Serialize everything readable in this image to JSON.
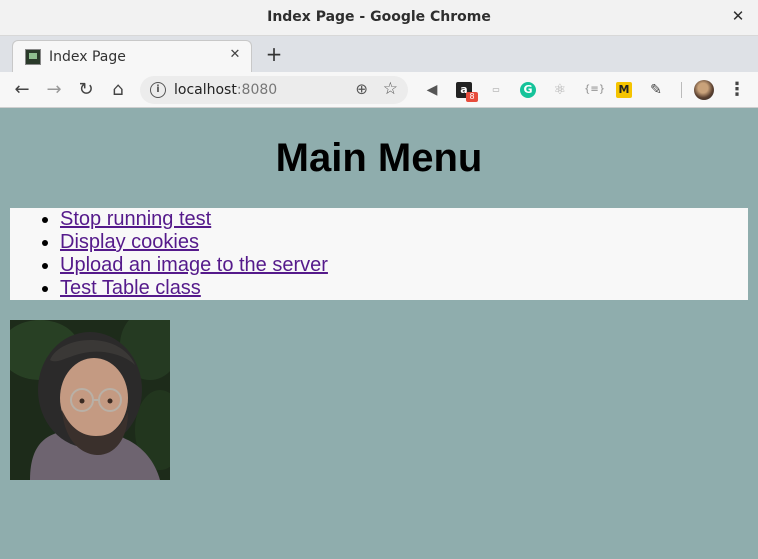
{
  "window": {
    "title": "Index Page - Google Chrome"
  },
  "tab": {
    "label": "Index Page"
  },
  "omnibox": {
    "host": "localhost",
    "port": ":8080"
  },
  "extensions": {
    "badge_count": "8"
  },
  "page": {
    "heading": "Main Menu",
    "links": [
      "Stop running test",
      "Display cookies",
      "Upload an image to the server",
      "Test Table class"
    ],
    "photo_alt": "portrait photo"
  },
  "colors": {
    "page_background": "#8fadad",
    "visited_link": "#551a8b",
    "menu_background": "#f8f8f8"
  }
}
